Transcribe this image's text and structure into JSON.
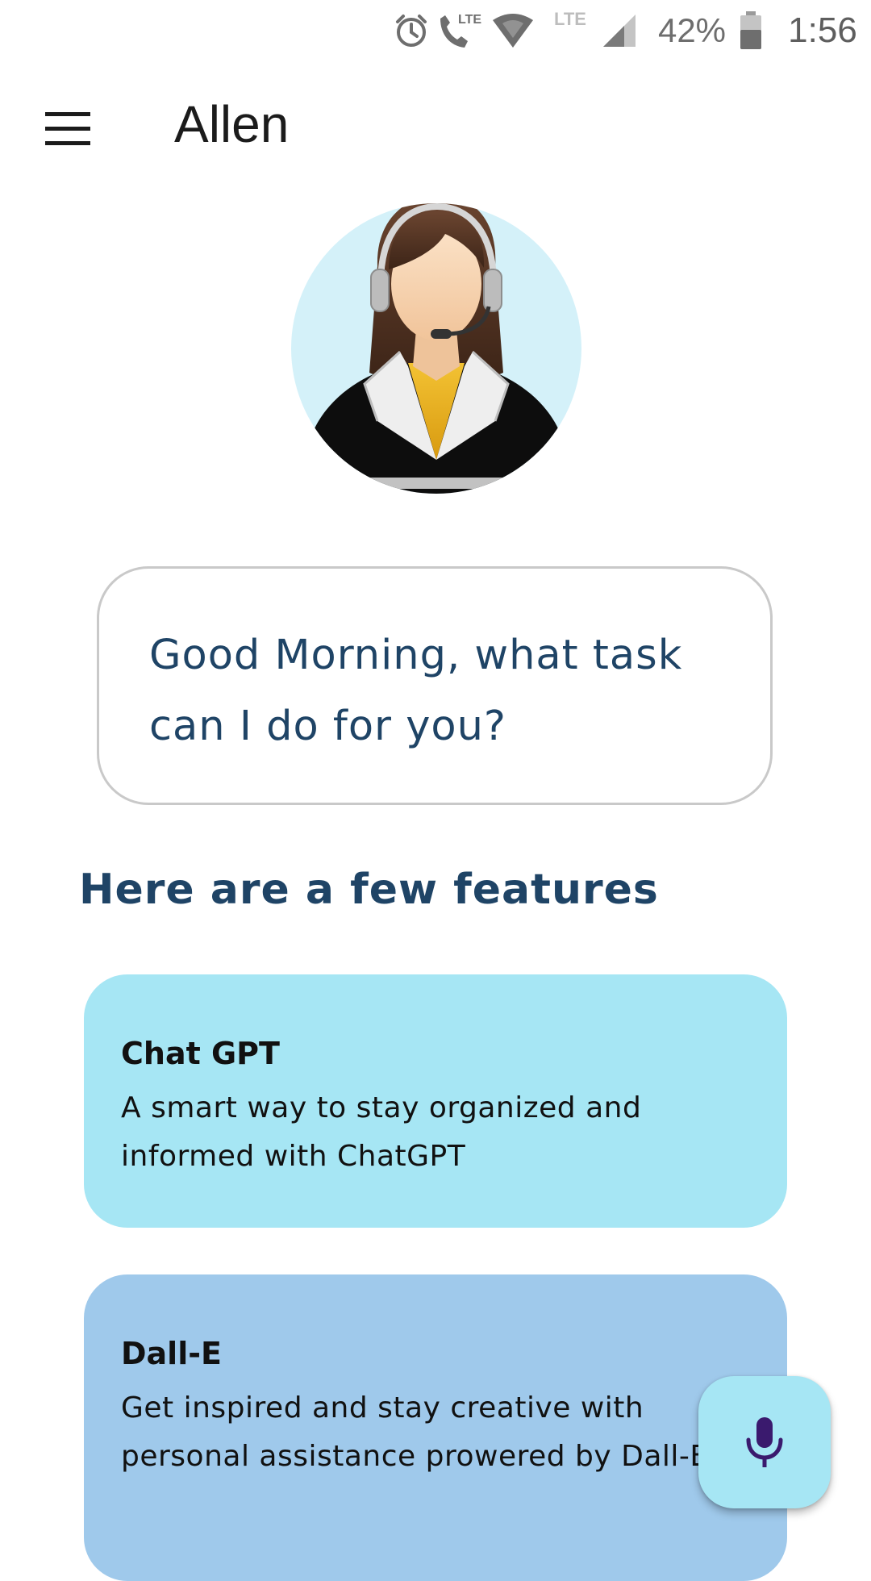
{
  "status_bar": {
    "battery_percent": "42%",
    "time": "1:56",
    "network_label_1": "LTE",
    "network_label_2": "LTE",
    "icons": [
      "alarm-icon",
      "volte-call-icon",
      "wifi-signal-icon",
      "cell-signal-icon",
      "battery-icon"
    ]
  },
  "app_bar": {
    "title": "Allen",
    "menu_icon": "hamburger-menu-icon"
  },
  "avatar": {
    "icon": "support-agent-avatar",
    "background_color": "#d4f1f9"
  },
  "greeting": {
    "text": "Good Morning, what task can I do for you?"
  },
  "features": {
    "heading": "Here are a few features",
    "items": [
      {
        "title": "Chat GPT",
        "description": "A smart way to stay organized and informed with ChatGPT",
        "color": "#a6e6f4"
      },
      {
        "title": "Dall-E",
        "description": "Get inspired and stay creative with personal assistance prowered by Dall-E",
        "color": "#9fc9eb"
      }
    ]
  },
  "fab": {
    "icon": "microphone-icon",
    "color": "#a6e6f4",
    "icon_color": "#3a1a6e"
  },
  "colors": {
    "heading_text": "#1f4466",
    "bubble_border": "#c9c9c9"
  }
}
